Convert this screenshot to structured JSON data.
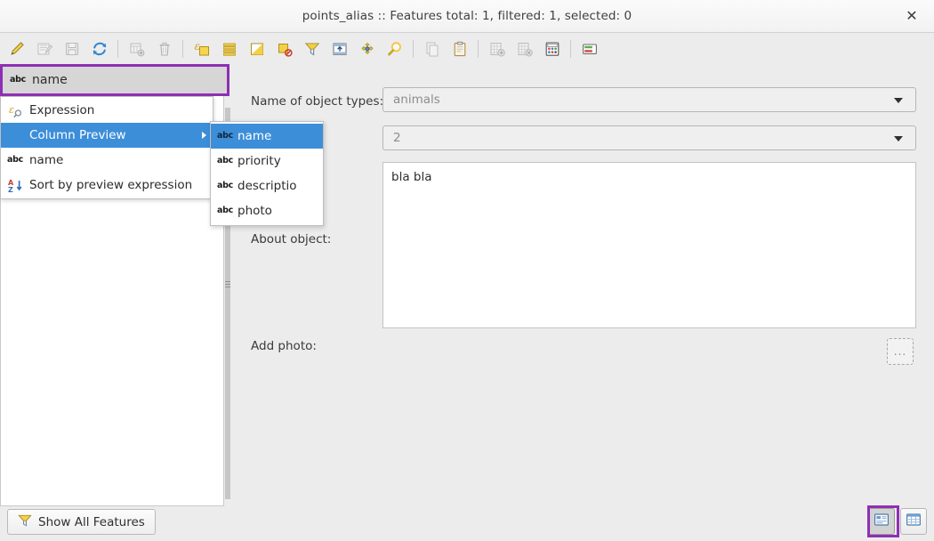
{
  "window": {
    "title": "points_alias :: Features total: 1, filtered: 1, selected: 0",
    "close_label": "✕"
  },
  "colors": {
    "highlight_blue": "#3d8ed9",
    "annotation_purple": "#8e2fb4",
    "window_bg": "#ececec",
    "panel_bg": "#ffffff",
    "disabled_text": "#8d8d8d"
  },
  "toolbar": {
    "items": [
      {
        "name": "toggle-editing-icon",
        "tip": "Toggle editing mode",
        "enabled": true
      },
      {
        "name": "save-edits-icon",
        "tip": "Save edits",
        "enabled": false
      },
      {
        "name": "save-layer-edits-icon",
        "tip": "Save layer edits",
        "enabled": false
      },
      {
        "name": "reload-table-icon",
        "tip": "Reload the table",
        "enabled": true
      },
      {
        "separator": true
      },
      {
        "name": "add-feature-icon",
        "tip": "Add feature",
        "enabled": false
      },
      {
        "name": "delete-selected-icon",
        "tip": "Delete selected features",
        "enabled": false
      },
      {
        "separator": true
      },
      {
        "name": "select-by-expression-icon",
        "tip": "Select features using an expression",
        "enabled": true
      },
      {
        "name": "select-all-icon",
        "tip": "Select all features",
        "enabled": true
      },
      {
        "name": "invert-selection-icon",
        "tip": "Invert selection",
        "enabled": true
      },
      {
        "name": "deselect-all-icon",
        "tip": "Deselect all features",
        "enabled": true
      },
      {
        "name": "filter-selection-icon",
        "tip": "Filter / Select features using form",
        "enabled": true
      },
      {
        "name": "move-selection-to-top-icon",
        "tip": "Move selection to top",
        "enabled": true
      },
      {
        "name": "pan-to-selection-icon",
        "tip": "Pan map to the selected rows",
        "enabled": true
      },
      {
        "name": "zoom-to-selection-icon",
        "tip": "Zoom map to the selected rows",
        "enabled": true
      },
      {
        "separator": true
      },
      {
        "name": "copy-features-icon",
        "tip": "Copy selected rows to clipboard",
        "enabled": false
      },
      {
        "name": "paste-features-icon",
        "tip": "Paste features from clipboard",
        "enabled": true
      },
      {
        "separator": true
      },
      {
        "name": "new-field-icon",
        "tip": "New field",
        "enabled": false
      },
      {
        "name": "delete-field-icon",
        "tip": "Delete field",
        "enabled": false
      },
      {
        "name": "field-calculator-icon",
        "tip": "Open field calculator",
        "enabled": true
      },
      {
        "separator": true
      },
      {
        "name": "conditional-formatting-icon",
        "tip": "Conditional formatting",
        "enabled": true
      }
    ]
  },
  "left_panel": {
    "preview_combo": {
      "icon": "abc-icon",
      "value": "name"
    },
    "context_menu": {
      "items": [
        {
          "label": "Expression",
          "icon": "expression-icon",
          "selected": false,
          "submenu": false
        },
        {
          "label": "Column Preview",
          "icon": "none",
          "selected": true,
          "submenu": true
        },
        {
          "label": "name",
          "icon": "abc-icon",
          "selected": false,
          "submenu": false
        },
        {
          "label": "Sort by preview expression",
          "icon": "sort-az-icon",
          "selected": false,
          "submenu": false
        }
      ]
    },
    "submenu": {
      "items": [
        {
          "label": "name",
          "icon": "abc-icon",
          "selected": true
        },
        {
          "label": "priority",
          "icon": "abc-icon",
          "selected": false
        },
        {
          "label": "descriptio",
          "icon": "abc-icon",
          "selected": false
        },
        {
          "label": "photo",
          "icon": "abc-icon",
          "selected": false
        }
      ]
    }
  },
  "form": {
    "fields": [
      {
        "label": "Name of object types:",
        "value": "animals",
        "control": "combobox"
      },
      {
        "label": "",
        "value": "2",
        "control": "combobox"
      },
      {
        "label": "About object:",
        "value": "bla bla",
        "control": "textarea"
      },
      {
        "label": "Add photo:",
        "value": "",
        "control": "file-picker",
        "button_label": "..."
      }
    ],
    "name_of_object_types_label": "Name of object types:",
    "name_of_object_types_value": "animals",
    "priority_value": "2",
    "about_object_label": "About object:",
    "about_object_value": "bla bla",
    "add_photo_label": "Add photo:",
    "browse_button_label": "..."
  },
  "bottom_bar": {
    "show_all_features_label": "Show All Features",
    "show_all_features_icon": "filter-funnel-icon",
    "view_toggles": [
      {
        "name": "form-view-toggle",
        "icon": "form-view-icon",
        "active": true
      },
      {
        "name": "table-view-toggle",
        "icon": "table-view-icon",
        "active": false
      }
    ]
  }
}
